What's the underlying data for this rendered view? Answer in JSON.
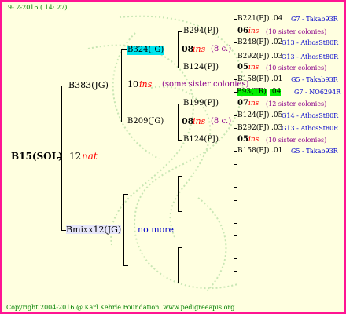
{
  "date": "9- 2-2016 ( 14: 27)",
  "copyright": "Copyright 2004-2016 @ Karl Kehrle Foundation.   www.pedigreeapis.org",
  "root": {
    "name": "B15(SOL)",
    "year": "12",
    "suffix": "nat"
  },
  "gen1": [
    {
      "name": "B383(JG)",
      "year": "10",
      "suffix": "ins",
      "note": "(some sister colonies)"
    },
    {
      "name": "Bmixx12(JG)",
      "note": "no more"
    }
  ],
  "gen2": [
    {
      "name": "B324(JG)",
      "year": "08",
      "suffix": "ins",
      "note": "(8 c.)"
    },
    {
      "name": "B209(JG)",
      "year": "08",
      "suffix": "ins",
      "note": "(8 c.)"
    }
  ],
  "gen3": [
    {
      "name": "B294(PJ)",
      "year": "06",
      "suffix": "ins",
      "note": "(10 sister colonies)"
    },
    {
      "name": "B124(PJ)",
      "year": "05",
      "suffix": "ins",
      "note": "(10 sister colonies)"
    },
    {
      "name": "B199(PJ)",
      "year": "07",
      "suffix": "ins",
      "note": "(12 sister colonies)"
    },
    {
      "name": "B124(PJ)",
      "year": "05",
      "suffix": "ins",
      "note": "(10 sister colonies)"
    }
  ],
  "gen4": [
    {
      "name": "B221(PJ)",
      "year": ".04",
      "code": "G7 - Takab93R"
    },
    {
      "name": "B248(PJ)",
      "year": ".02",
      "code": "G13 - AthosSt80R"
    },
    {
      "name": "B292(PJ)",
      "year": ".03",
      "code": "G13 - AthosSt80R"
    },
    {
      "name": "B158(PJ)",
      "year": ".01",
      "code": "G5 - Takab93R"
    },
    {
      "name": "B93(TR)",
      "year": ".04",
      "code": "G7 - NO6294R"
    },
    {
      "name": "B124(PJ)",
      "year": ".05",
      "code": "G14 - AthosSt80R"
    },
    {
      "name": "B292(PJ)",
      "year": ".03",
      "code": "G13 - AthosSt80R"
    },
    {
      "name": "B158(PJ)",
      "year": ".01",
      "code": "G5 - Takab93R"
    }
  ]
}
